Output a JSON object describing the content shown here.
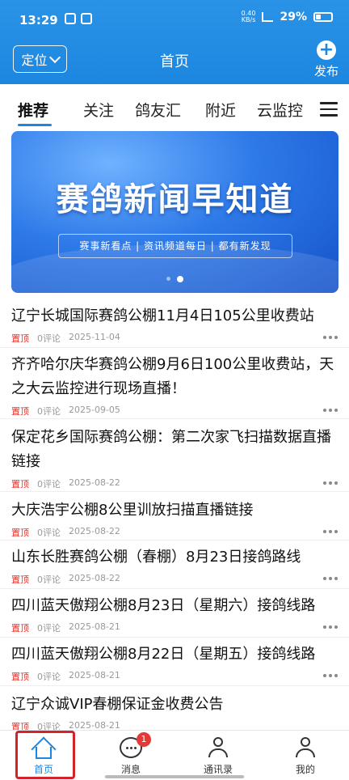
{
  "status_bar": {
    "time": "13:29",
    "net_speed": "0.40",
    "net_unit": "KB/s",
    "battery": "29%"
  },
  "app_bar": {
    "location_label": "定位",
    "title": "首页",
    "publish_label": "发布"
  },
  "tabs": [
    {
      "label": "推荐",
      "active": true
    },
    {
      "label": "关注"
    },
    {
      "label": "鸽友汇"
    },
    {
      "label": "附近"
    },
    {
      "label": "云监控"
    }
  ],
  "banner": {
    "title": "赛鸽新闻早知道",
    "subtitle": "赛事新看点 | 资讯频道每日 | 都有新发现"
  },
  "news": [
    {
      "title": "辽宁长城国际赛鸽公棚11月4日105公里收费站",
      "tag": "置顶",
      "comments": "0评论",
      "date": "2025-11-04"
    },
    {
      "title": "齐齐哈尔庆华赛鸽公棚9月6日100公里收费站，天之大云监控进行现场直播！",
      "tag": "置顶",
      "comments": "0评论",
      "date": "2025-09-05"
    },
    {
      "title": "保定花乡国际赛鸽公棚：第二次家飞扫描数据直播链接",
      "tag": "置顶",
      "comments": "0评论",
      "date": "2025-08-22"
    },
    {
      "title": "大庆浩宇公棚8公里训放扫描直播链接",
      "tag": "置顶",
      "comments": "0评论",
      "date": "2025-08-22"
    },
    {
      "title": "山东长胜赛鸽公棚（春棚）8月23日接鸽路线",
      "tag": "置顶",
      "comments": "0评论",
      "date": "2025-08-22"
    },
    {
      "title": "四川蓝天傲翔公棚8月23日（星期六）接鸽线路",
      "tag": "置顶",
      "comments": "0评论",
      "date": "2025-08-21"
    },
    {
      "title": "四川蓝天傲翔公棚8月22日（星期五）接鸽线路",
      "tag": "置顶",
      "comments": "0评论",
      "date": "2025-08-21"
    },
    {
      "title": "辽宁众诚VIP春棚保证金收费公告",
      "tag": "置顶",
      "comments": "0评论",
      "date": "2025-08-21"
    }
  ],
  "bottom_nav": [
    {
      "label": "首页",
      "icon": "home-icon",
      "active": true
    },
    {
      "label": "消息",
      "icon": "message-icon",
      "badge": "1"
    },
    {
      "label": "通讯录",
      "icon": "contacts-icon"
    },
    {
      "label": "我的",
      "icon": "profile-icon"
    }
  ],
  "colors": {
    "primary": "#1d86e0",
    "pin": "#e0362f",
    "badge": "#e53935",
    "highlight": "#d3232a"
  }
}
